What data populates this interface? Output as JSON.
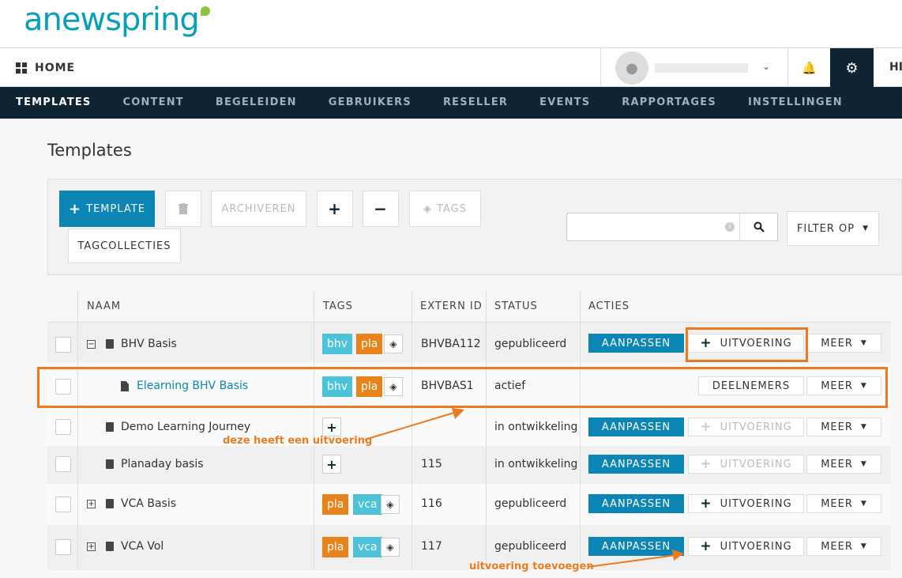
{
  "logo": {
    "text": "anewspring"
  },
  "topbar": {
    "home_label": "HOME",
    "help_label": "HI"
  },
  "nav": {
    "items": [
      "TEMPLATES",
      "CONTENT",
      "BEGELEIDEN",
      "GEBRUIKERS",
      "RESELLER",
      "EVENTS",
      "RAPPORTAGES",
      "INSTELLINGEN"
    ],
    "active": "TEMPLATES"
  },
  "page": {
    "title": "Templates"
  },
  "toolbar": {
    "add_template": "TEMPLATE",
    "archive": "ARCHIVEREN",
    "tags": "TAGS",
    "tagcollections": "TAGCOLLECTIES",
    "filter": "FILTER OP",
    "search_placeholder": ""
  },
  "table": {
    "headers": {
      "name": "NAAM",
      "tags": "TAGS",
      "extern_id": "EXTERN ID",
      "status": "STATUS",
      "actions": "ACTIES"
    },
    "rows": [
      {
        "name": "BHV Basis",
        "tags": [
          "bhv",
          "pla"
        ],
        "extern_id": "BHVBA112",
        "status": "gepubliceerd",
        "btn1": "AANPASSEN",
        "btn2": "UITVOERING",
        "btn3": "MEER"
      },
      {
        "name": "Elearning BHV Basis",
        "tags": [
          "bhv",
          "pla"
        ],
        "extern_id": "BHVBAS1",
        "status": "actief",
        "btn2": "DEELNEMERS",
        "btn3": "MEER"
      },
      {
        "name": "Demo Learning Journey",
        "tags": [],
        "extern_id": "",
        "status": "in ontwikkeling",
        "btn1": "AANPASSEN",
        "btn2": "UITVOERING",
        "btn3": "MEER"
      },
      {
        "name": "Planaday basis",
        "tags": [],
        "extern_id": "115",
        "status": "in ontwikkeling",
        "btn1": "AANPASSEN",
        "btn2": "UITVOERING",
        "btn3": "MEER"
      },
      {
        "name": "VCA Basis",
        "tags": [
          "pla",
          "vca"
        ],
        "extern_id": "116",
        "status": "gepubliceerd",
        "btn1": "AANPASSEN",
        "btn2": "UITVOERING",
        "btn3": "MEER"
      },
      {
        "name": "VCA Vol",
        "tags": [
          "pla",
          "vca"
        ],
        "extern_id": "117",
        "status": "gepubliceerd",
        "btn1": "AANPASSEN",
        "btn2": "UITVOERING",
        "btn3": "MEER"
      }
    ]
  },
  "annotations": {
    "has_execution": "deze heeft een uitvoering",
    "add_execution": "uitvoering toevoegen"
  },
  "colors": {
    "accent": "#0b86b4",
    "nav_bg": "#0f2433",
    "annotation": "#ec7a21",
    "tag_blue": "#4cc3d9",
    "tag_orange": "#e8831c"
  }
}
